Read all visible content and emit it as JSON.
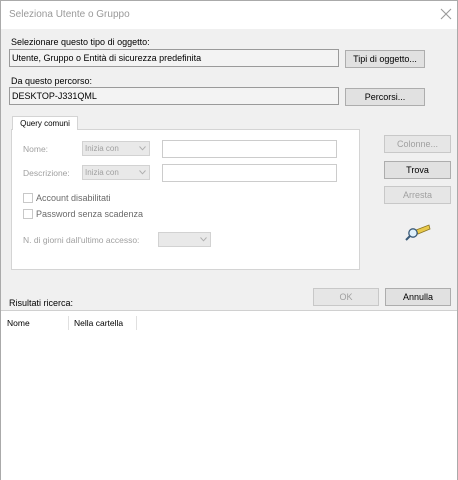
{
  "window": {
    "title": "Seleziona Utente o Gruppo"
  },
  "object_type": {
    "label": "Selezionare questo tipo di oggetto:",
    "value": "Utente, Gruppo o Entità di sicurezza predefinita",
    "button": "Tipi di oggetto..."
  },
  "location": {
    "label": "Da questo percorso:",
    "value": "DESKTOP-J331QML",
    "button": "Percorsi..."
  },
  "tab": {
    "label": "Query comuni"
  },
  "query": {
    "name_label": "Nome:",
    "name_combo": "Inizia con",
    "desc_label": "Descrizione:",
    "desc_combo": "Inizia con",
    "disabled_accounts": "Account disabilitati",
    "no_expiry": "Password senza scadenza",
    "days_label": "N. di giorni dall'ultimo accesso:"
  },
  "side_buttons": {
    "columns": "Colonne...",
    "find": "Trova",
    "stop": "Arresta"
  },
  "footer": {
    "ok": "OK",
    "cancel": "Annulla"
  },
  "results": {
    "label": "Risultati ricerca:",
    "columns": [
      "Nome",
      "Nella cartella"
    ]
  },
  "icons": {
    "close": "close-icon",
    "search": "magnifier-icon"
  }
}
